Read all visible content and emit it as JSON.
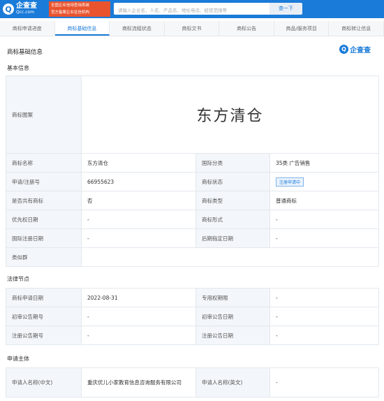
{
  "header": {
    "logo_text": "企查查",
    "logo_sub": "Qcc.com",
    "badge_line1": "全国企业信用查询系统",
    "badge_line2": "官方备案企业征信机构",
    "search_placeholder": "请输入企业名、人名、产品名、地址电话、经营范围等",
    "search_button": "查一下"
  },
  "tabs": [
    {
      "label": "商标申请进度"
    },
    {
      "label": "商标基础信息",
      "active": true
    },
    {
      "label": "商标流程状态"
    },
    {
      "label": "商标文书"
    },
    {
      "label": "商标公告"
    },
    {
      "label": "商品/服务项目"
    },
    {
      "label": "商标转让信息"
    }
  ],
  "page_title": "商标基础信息",
  "brand_logo_text": "企查查",
  "basic": {
    "section_title": "基本信息",
    "image_label": "商标图案",
    "image_text": "东方清仓",
    "rows": [
      {
        "k1": "商标名称",
        "v1": "东方清仓",
        "k2": "国际分类",
        "v2": "35类 广告销售"
      },
      {
        "k1": "申请/注册号",
        "v1": "66955623",
        "k2": "商标状态",
        "v2": "注册申请中"
      },
      {
        "k1": "是否共有商标",
        "v1": "否",
        "k2": "商标类型",
        "v2": "普通商标"
      },
      {
        "k1": "优先权日期",
        "v1": "-",
        "k2": "商标形式",
        "v2": "-"
      },
      {
        "k1": "国际注册日期",
        "v1": "-",
        "k2": "后期指定日期",
        "v2": "-"
      }
    ],
    "similar_label": "类似群",
    "similar_value": ""
  },
  "legal": {
    "section_title": "法律节点",
    "rows": [
      {
        "k1": "商标申请日期",
        "v1": "2022-08-31",
        "k2": "专用权期限",
        "v2": "-"
      },
      {
        "k1": "初审公告期号",
        "v1": "-",
        "k2": "初审公告日期",
        "v2": "-"
      },
      {
        "k1": "注册公告期号",
        "v1": "-",
        "k2": "注册公告日期",
        "v2": "-"
      }
    ]
  },
  "applicant": {
    "section_title": "申请主体",
    "k1": "申请人名称(中文)",
    "v1": "重庆优儿小家教育信息咨询服务有限公司",
    "k2": "申请人名称(英文)",
    "v2": "-"
  },
  "colors": {
    "primary": "#1a7bd8",
    "badge": "#e9542f",
    "key_bg": "#f3f6fa"
  }
}
